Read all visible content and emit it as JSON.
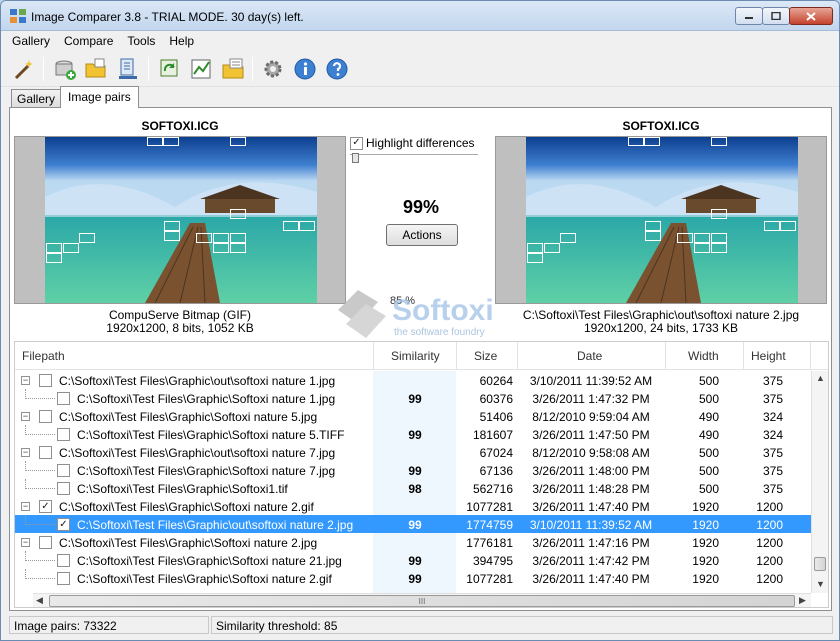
{
  "window": {
    "title": "Image Comparer 3.8 - TRIAL MODE. 30 day(s) left."
  },
  "menu": [
    "Gallery",
    "Compare",
    "Tools",
    "Help"
  ],
  "toolbar_icons": [
    "wizard-icon",
    "add-disk-icon",
    "open-folder-icon",
    "scan-icon",
    "refresh-compare-icon",
    "chart-icon",
    "folder-list-icon",
    "settings-gear-icon",
    "info-icon",
    "help-icon"
  ],
  "tabs": [
    {
      "label": "Gallery"
    },
    {
      "label": "Image pairs"
    }
  ],
  "left_image": {
    "name": "SOFTOXI.ICG",
    "format": "CompuServe Bitmap (GIF)",
    "info": "1920x1200, 8 bits, 1052 KB"
  },
  "right_image": {
    "name": "SOFTOXI.ICG",
    "path": "C:\\Softoxi\\Test Files\\Graphic\\out\\softoxi nature 2.jpg",
    "info": "1920x1200, 24 bits, 1733 KB"
  },
  "compare": {
    "highlight_label": "Highlight differences",
    "highlight_checked": true,
    "similarity": "99%",
    "actions_label": "Actions",
    "threshold": "85 %",
    "threshold_slider_fraction": 0.0
  },
  "watermark": {
    "text": "Softoxi",
    "tagline": "the software foundry"
  },
  "columns": [
    "Filepath",
    "Similarity",
    "Size",
    "Date",
    "Width",
    "Height"
  ],
  "rows": [
    {
      "level": 0,
      "path": "C:\\Softoxi\\Test Files\\Graphic\\out\\softoxi nature 1.jpg",
      "sim": "",
      "size": "60264",
      "date": "3/10/2011 11:39:52 AM",
      "w": "500",
      "h": "375",
      "checked": false,
      "selected": false
    },
    {
      "level": 1,
      "path": "C:\\Softoxi\\Test Files\\Graphic\\Softoxi nature 1.jpg",
      "sim": "99",
      "size": "60376",
      "date": "3/26/2011 1:47:32 PM",
      "w": "500",
      "h": "375",
      "checked": false,
      "selected": false
    },
    {
      "level": 0,
      "path": "C:\\Softoxi\\Test Files\\Graphic\\Softoxi nature 5.jpg",
      "sim": "",
      "size": "51406",
      "date": "8/12/2010 9:59:04 AM",
      "w": "490",
      "h": "324",
      "checked": false,
      "selected": false
    },
    {
      "level": 1,
      "path": "C:\\Softoxi\\Test Files\\Graphic\\Softoxi nature 5.TIFF",
      "sim": "99",
      "size": "181607",
      "date": "3/26/2011 1:47:50 PM",
      "w": "490",
      "h": "324",
      "checked": false,
      "selected": false
    },
    {
      "level": 0,
      "path": "C:\\Softoxi\\Test Files\\Graphic\\out\\softoxi nature 7.jpg",
      "sim": "",
      "size": "67024",
      "date": "8/12/2010 9:58:08 AM",
      "w": "500",
      "h": "375",
      "checked": false,
      "selected": false
    },
    {
      "level": 1,
      "path": "C:\\Softoxi\\Test Files\\Graphic\\Softoxi nature 7.jpg",
      "sim": "99",
      "size": "67136",
      "date": "3/26/2011 1:48:00 PM",
      "w": "500",
      "h": "375",
      "checked": false,
      "selected": false
    },
    {
      "level": 1,
      "path": "C:\\Softoxi\\Test Files\\Graphic\\Softoxi1.tif",
      "sim": "98",
      "size": "562716",
      "date": "3/26/2011 1:48:28 PM",
      "w": "500",
      "h": "375",
      "checked": false,
      "selected": false
    },
    {
      "level": 0,
      "path": "C:\\Softoxi\\Test Files\\Graphic\\Softoxi nature 2.gif",
      "sim": "",
      "size": "1077281",
      "date": "3/26/2011 1:47:40 PM",
      "w": "1920",
      "h": "1200",
      "checked": true,
      "selected": false
    },
    {
      "level": 1,
      "path": "C:\\Softoxi\\Test Files\\Graphic\\out\\softoxi nature 2.jpg",
      "sim": "99",
      "size": "1774759",
      "date": "3/10/2011 11:39:52 AM",
      "w": "1920",
      "h": "1200",
      "checked": true,
      "selected": true
    },
    {
      "level": 0,
      "path": "C:\\Softoxi\\Test Files\\Graphic\\Softoxi nature 2.jpg",
      "sim": "",
      "size": "1776181",
      "date": "3/26/2011 1:47:16 PM",
      "w": "1920",
      "h": "1200",
      "checked": false,
      "selected": false
    },
    {
      "level": 1,
      "path": "C:\\Softoxi\\Test Files\\Graphic\\Softoxi nature 21.jpg",
      "sim": "99",
      "size": "394795",
      "date": "3/26/2011 1:47:42 PM",
      "w": "1920",
      "h": "1200",
      "checked": false,
      "selected": false
    },
    {
      "level": 1,
      "path": "C:\\Softoxi\\Test Files\\Graphic\\Softoxi nature 2.gif",
      "sim": "99",
      "size": "1077281",
      "date": "3/26/2011 1:47:40 PM",
      "w": "1920",
      "h": "1200",
      "checked": false,
      "selected": false
    }
  ],
  "hscroll_grip": "III",
  "status": {
    "pairs": "Image pairs: 73322",
    "threshold": "Similarity threshold: 85"
  },
  "colors": {
    "selection": "#3399ff",
    "similarity_column": "#eef7fd",
    "titlebar": "#c2d6ee"
  }
}
